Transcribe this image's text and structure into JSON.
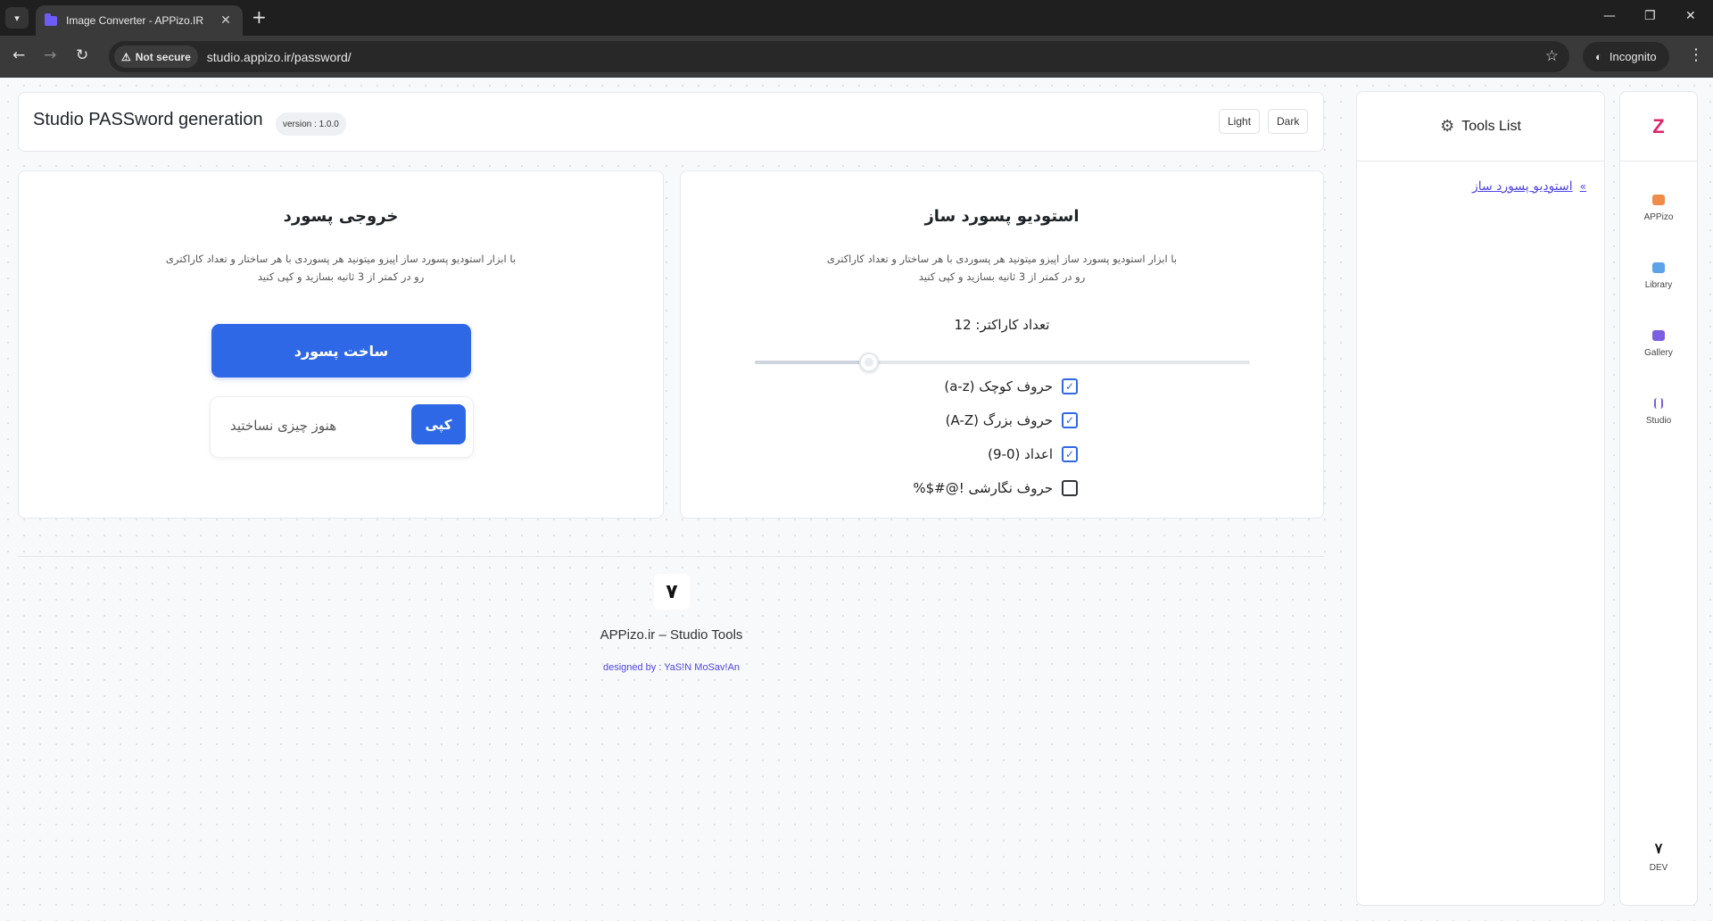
{
  "browser": {
    "tab_title": "Image Converter - APPizo.IR",
    "security_label": "Not secure",
    "url": "studio.appizo.ir/password/",
    "incognito_label": "Incognito"
  },
  "header": {
    "title": "Studio PASSword generation",
    "version": "version : 1.0.0",
    "light_label": "Light",
    "dark_label": "Dark"
  },
  "output_panel": {
    "title": "خروجی پسورد",
    "desc_line1": "با ابزار استودیو پسورد ساز اپیزو میتونید هر پسوردی با هر ساختار و تعداد کاراکتری",
    "desc_line2": "رو در کمتر از 3 ثانیه بسازید و کپی کنید",
    "generate_label": "ساخت پسورد",
    "copy_label": "کپی",
    "result_placeholder": "هنوز چیزی نساختید"
  },
  "settings_panel": {
    "title": "استودیو پسورد ساز",
    "desc_line1": "با ابزار استودیو پسورد ساز اپیزو میتونید هر پسوردی با هر ساختار و تعداد کاراکتری",
    "desc_line2": "رو در کمتر از 3 ثانیه بسازید و کپی کنید",
    "count_label": "تعداد کاراکتر: 12",
    "slider_fraction": 0.23,
    "options": [
      {
        "label": "حروف کوچک (a-z)",
        "checked": true
      },
      {
        "label": "حروف بزرگ (A-Z)",
        "checked": true
      },
      {
        "label": "اعداد (0-9)",
        "checked": true
      },
      {
        "label": "حروف نگارشی !@#$%",
        "checked": false
      }
    ]
  },
  "footer": {
    "logo": "۷",
    "text": "APPizo.ir – Studio Tools",
    "credit": "designed by : YaS!N MoSav!An"
  },
  "tools": {
    "title": "Tools List",
    "link": "استودیو پسورد ساز"
  },
  "rail": {
    "logo": "Z",
    "items": [
      {
        "label": "APPizo",
        "color": "#f08c4a"
      },
      {
        "label": "Library",
        "color": "#5aa3e8"
      },
      {
        "label": "Gallery",
        "color": "#7b5fe0"
      },
      {
        "label": "Studio",
        "color": "#7b5fe0"
      }
    ],
    "dev_glyph": "۷",
    "dev_label": "DEV"
  }
}
